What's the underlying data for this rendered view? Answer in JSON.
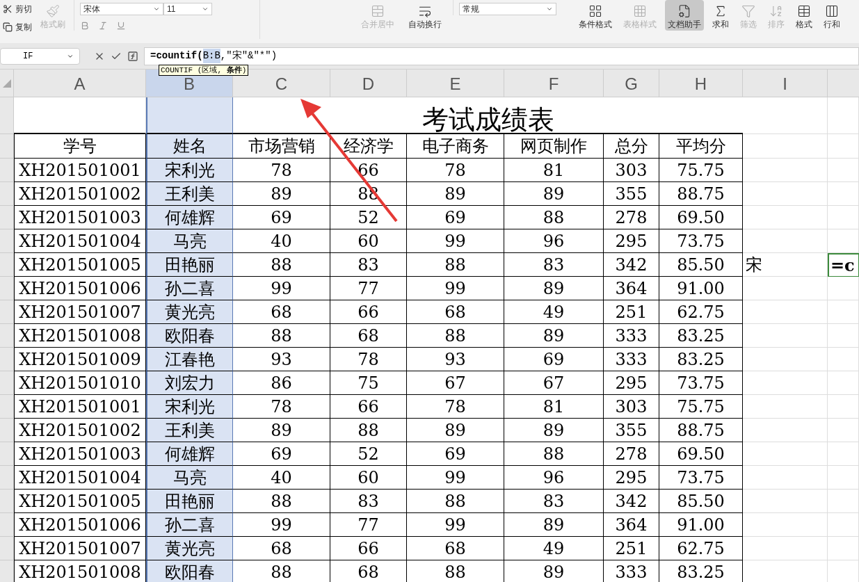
{
  "ribbon": {
    "clipboard": [
      {
        "label": "剪切",
        "disabled": false
      },
      {
        "label": "复制",
        "disabled": false
      }
    ],
    "format_painter": {
      "label": "格式刷",
      "disabled": true
    },
    "font": {
      "name": "宋体",
      "size": "11"
    },
    "large_buttons": [
      {
        "kind": "merge",
        "label": "合并居中",
        "disabled": true,
        "selected": false
      },
      {
        "kind": "wrap",
        "label": "自动换行",
        "disabled": false,
        "selected": false
      }
    ],
    "number_format": "常规",
    "tools": [
      {
        "kind": "cond",
        "label": "条件格式",
        "disabled": false,
        "selected": false
      },
      {
        "kind": "style",
        "label": "表格样式",
        "disabled": true,
        "selected": false
      },
      {
        "kind": "assistant",
        "label": "文档助手",
        "disabled": false,
        "selected": true
      },
      {
        "kind": "sum",
        "label": "求和",
        "disabled": false,
        "selected": false
      },
      {
        "kind": "filter",
        "label": "筛选",
        "disabled": true,
        "selected": false
      },
      {
        "kind": "sort",
        "label": "排序",
        "disabled": true,
        "selected": false
      },
      {
        "kind": "format",
        "label": "格式",
        "disabled": false,
        "selected": false
      },
      {
        "kind": "rowcol",
        "label": "行和",
        "disabled": false,
        "selected": false
      }
    ]
  },
  "formula_bar": {
    "name_box": "IF",
    "formula_start": "=countif(",
    "formula_ref": "B:B",
    "formula_end": ",\"宋\"&\"*\")",
    "tooltip": "COUNTIF (区域, **条件**)"
  },
  "columns": [
    {
      "label": "A",
      "selected": false
    },
    {
      "label": "B",
      "selected": true
    },
    {
      "label": "C",
      "selected": false
    },
    {
      "label": "D",
      "selected": false
    },
    {
      "label": "E",
      "selected": false
    },
    {
      "label": "F",
      "selected": false
    },
    {
      "label": "G",
      "selected": false
    },
    {
      "label": "H",
      "selected": false
    },
    {
      "label": "I",
      "selected": false
    }
  ],
  "title": "考试成绩表",
  "headers": [
    "学号",
    "姓名",
    "市场营销",
    "经济学",
    "电子商务",
    "网页制作",
    "总分",
    "平均分"
  ],
  "rows": [
    {
      "cells": [
        "XH201501001",
        "宋利光",
        "78",
        "66",
        "78",
        "81",
        "303",
        "75.75"
      ]
    },
    {
      "cells": [
        "XH201501002",
        "王利美",
        "89",
        "88",
        "89",
        "89",
        "355",
        "88.75"
      ]
    },
    {
      "cells": [
        "XH201501003",
        "何雄辉",
        "69",
        "52",
        "69",
        "88",
        "278",
        "69.50"
      ]
    },
    {
      "cells": [
        "XH201501004",
        "马亮",
        "40",
        "60",
        "99",
        "96",
        "295",
        "73.75"
      ]
    },
    {
      "cells": [
        "XH201501005",
        "田艳丽",
        "88",
        "83",
        "88",
        "83",
        "342",
        "85.50"
      ],
      "extra": "宋",
      "editing": "=c"
    },
    {
      "cells": [
        "XH201501006",
        "孙二喜",
        "99",
        "77",
        "99",
        "89",
        "364",
        "91.00"
      ]
    },
    {
      "cells": [
        "XH201501007",
        "黄光亮",
        "68",
        "66",
        "68",
        "49",
        "251",
        "62.75"
      ]
    },
    {
      "cells": [
        "XH201501008",
        "欧阳春",
        "88",
        "68",
        "88",
        "89",
        "333",
        "83.25"
      ]
    },
    {
      "cells": [
        "XH201501009",
        "江春艳",
        "93",
        "78",
        "93",
        "69",
        "333",
        "83.25"
      ]
    },
    {
      "cells": [
        "XH201501010",
        "刘宏力",
        "86",
        "75",
        "67",
        "67",
        "295",
        "73.75"
      ]
    },
    {
      "cells": [
        "XH201501001",
        "宋利光",
        "78",
        "66",
        "78",
        "81",
        "303",
        "75.75"
      ]
    },
    {
      "cells": [
        "XH201501002",
        "王利美",
        "89",
        "88",
        "89",
        "89",
        "355",
        "88.75"
      ]
    },
    {
      "cells": [
        "XH201501003",
        "何雄辉",
        "69",
        "52",
        "69",
        "88",
        "278",
        "69.50"
      ]
    },
    {
      "cells": [
        "XH201501004",
        "马亮",
        "40",
        "60",
        "99",
        "96",
        "295",
        "73.75"
      ]
    },
    {
      "cells": [
        "XH201501005",
        "田艳丽",
        "88",
        "83",
        "88",
        "83",
        "342",
        "85.50"
      ]
    },
    {
      "cells": [
        "XH201501006",
        "孙二喜",
        "99",
        "77",
        "99",
        "89",
        "364",
        "91.00"
      ]
    },
    {
      "cells": [
        "XH201501007",
        "黄光亮",
        "68",
        "66",
        "68",
        "49",
        "251",
        "62.75"
      ]
    },
    {
      "cells": [
        "XH201501008",
        "欧阳春",
        "88",
        "68",
        "88",
        "89",
        "333",
        "83.25"
      ]
    }
  ]
}
